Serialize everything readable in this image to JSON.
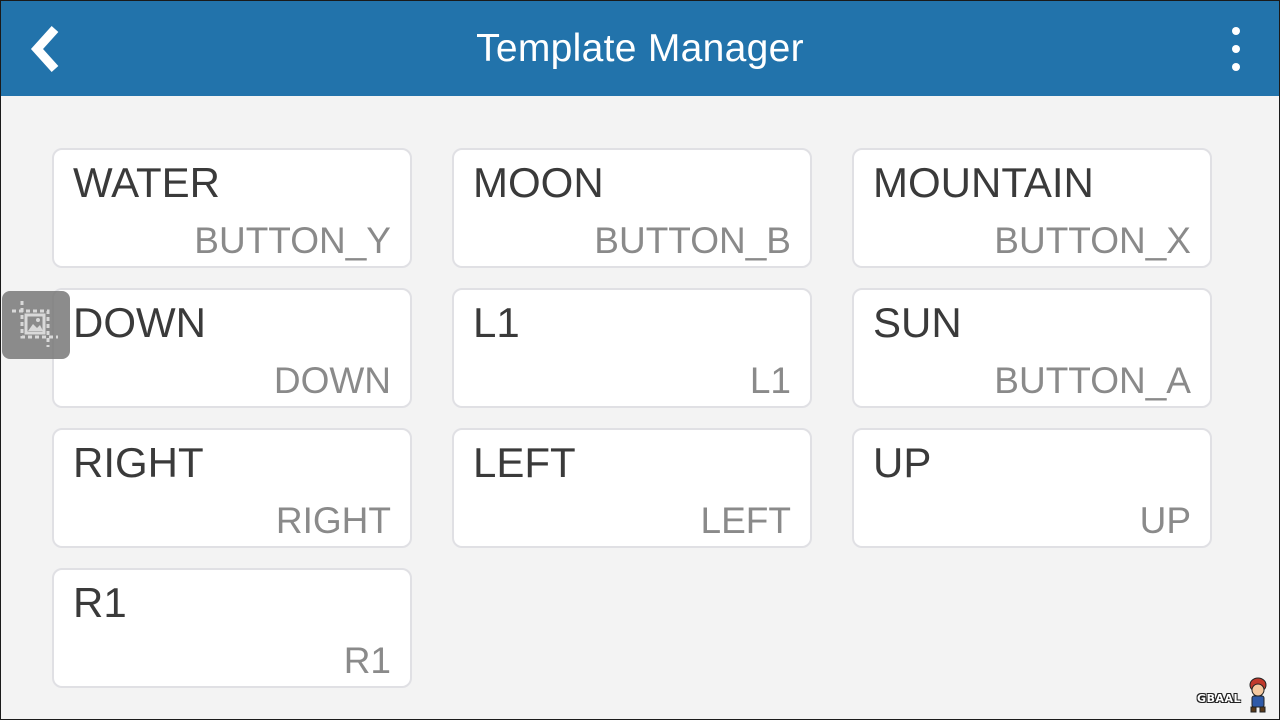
{
  "header": {
    "title": "Template Manager",
    "back_icon": "chevron-left-icon",
    "menu_icon": "overflow-menu-icon",
    "background": "#2273ab"
  },
  "templates": [
    {
      "name": "WATER",
      "mapping": "BUTTON_Y"
    },
    {
      "name": "MOON",
      "mapping": "BUTTON_B"
    },
    {
      "name": "MOUNTAIN",
      "mapping": "BUTTON_X"
    },
    {
      "name": "DOWN",
      "mapping": "DOWN"
    },
    {
      "name": "L1",
      "mapping": "L1"
    },
    {
      "name": "SUN",
      "mapping": "BUTTON_A"
    },
    {
      "name": "RIGHT",
      "mapping": "RIGHT"
    },
    {
      "name": "LEFT",
      "mapping": "LEFT"
    },
    {
      "name": "UP",
      "mapping": "UP"
    },
    {
      "name": "R1",
      "mapping": "R1"
    }
  ],
  "floating_tool": {
    "icon": "screenshot-crop-icon"
  },
  "watermark": {
    "text": "GBAAL"
  }
}
